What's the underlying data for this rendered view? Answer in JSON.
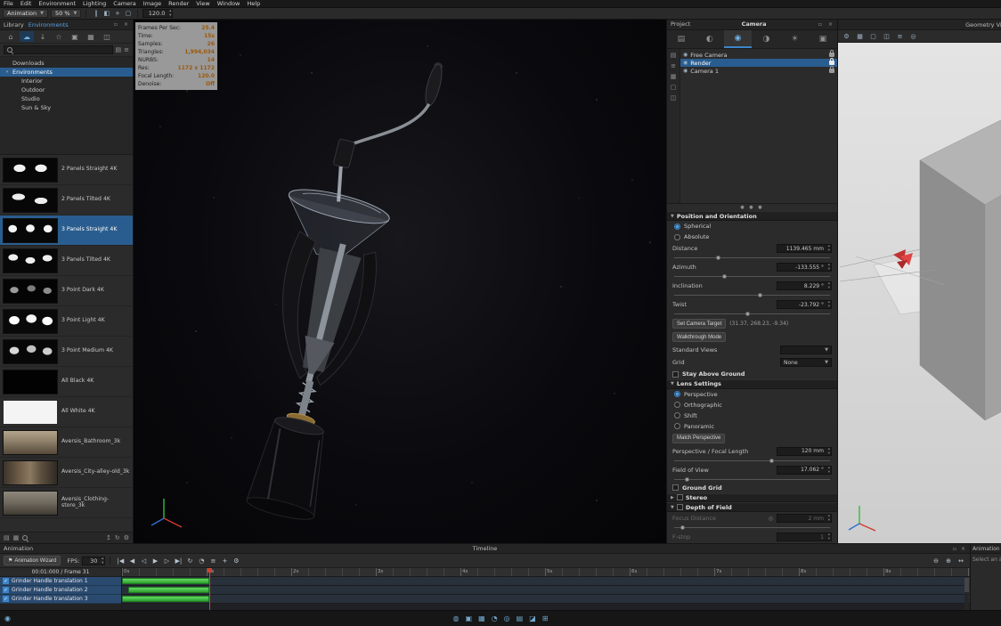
{
  "colors": {
    "accent": "#3d85c8",
    "selection": "#2a5d8f",
    "value_orange": "#c07a28",
    "track_green": "#3fc43f",
    "playhead_red": "#cc4433"
  },
  "menu": {
    "items": [
      "File",
      "Edit",
      "Environment",
      "Lighting",
      "Camera",
      "Image",
      "Render",
      "View",
      "Window",
      "Help"
    ]
  },
  "top_toolbar": {
    "animation_select": "Animation",
    "zoom_select": "50 %",
    "focal_value": "120.0",
    "icons": [
      {
        "name": "pause-icon",
        "glyph": "‖"
      },
      {
        "name": "keyframe-icon",
        "glyph": "◧"
      },
      {
        "name": "move-tool-icon",
        "glyph": "+"
      },
      {
        "name": "region-icon",
        "glyph": "▢"
      }
    ]
  },
  "library": {
    "title": "Library",
    "tab": "Environments",
    "toolbar_icons": [
      {
        "name": "home-icon",
        "glyph": "⌂",
        "active": false
      },
      {
        "name": "cloud-icon",
        "glyph": "☁",
        "active": true
      },
      {
        "name": "download-icon",
        "glyph": "↓",
        "active": false
      },
      {
        "name": "favorites-icon",
        "glyph": "☆",
        "active": false
      },
      {
        "name": "materials-icon",
        "glyph": "▣",
        "active": false
      },
      {
        "name": "textures-icon",
        "glyph": "▦",
        "active": false
      },
      {
        "name": "models-icon",
        "glyph": "◫",
        "active": false
      }
    ],
    "tree": [
      {
        "label": "Downloads",
        "depth": 0,
        "selected": false,
        "caret": ""
      },
      {
        "label": "Environments",
        "depth": 0,
        "selected": true,
        "caret": "▾"
      },
      {
        "label": "Interior",
        "depth": 1,
        "selected": false,
        "caret": ""
      },
      {
        "label": "Outdoor",
        "depth": 1,
        "selected": false,
        "caret": ""
      },
      {
        "label": "Studio",
        "depth": 1,
        "selected": false,
        "caret": ""
      },
      {
        "label": "Sun & Sky",
        "depth": 1,
        "selected": false,
        "caret": ""
      }
    ],
    "items": [
      {
        "label": "2 Panels Straight 4K",
        "thumb": "panels2",
        "selected": false
      },
      {
        "label": "2 Panels Tilted 4K",
        "thumb": "panels2t",
        "selected": false
      },
      {
        "label": "3 Panels Straight 4K",
        "thumb": "panels3",
        "selected": true
      },
      {
        "label": "3 Panels Tilted 4K",
        "thumb": "panels3t",
        "selected": false
      },
      {
        "label": "3 Point Dark 4K",
        "thumb": "pointdark",
        "selected": false
      },
      {
        "label": "3 Point Light 4K",
        "thumb": "pointlight",
        "selected": false
      },
      {
        "label": "3 Point Medium 4K",
        "thumb": "pointmedium",
        "selected": false
      },
      {
        "label": "All Black 4K",
        "thumb": "black",
        "selected": false
      },
      {
        "label": "All White 4K",
        "thumb": "white",
        "selected": false
      },
      {
        "label": "Aversis_Bathroom_3k",
        "thumb": "bathroom",
        "selected": false
      },
      {
        "label": "Aversis_City-alley-old_3k",
        "thumb": "city",
        "selected": false
      },
      {
        "label": "Aversis_Clothing-store_3k",
        "thumb": "store",
        "selected": false
      }
    ],
    "footer_icons_left": [
      {
        "name": "list-view-icon",
        "glyph": "▤"
      },
      {
        "name": "grid-view-icon",
        "glyph": "▦"
      },
      {
        "name": "search-icon",
        "glyph": "mag"
      }
    ],
    "footer_icons_right": [
      {
        "name": "import-icon",
        "glyph": "↥"
      },
      {
        "name": "refresh-icon",
        "glyph": "↻"
      },
      {
        "name": "settings-icon",
        "glyph": "⚙"
      }
    ]
  },
  "viewport": {
    "stats": [
      {
        "label": "Frames Per Sec:",
        "value": "25.4"
      },
      {
        "label": "Time:",
        "value": "15s"
      },
      {
        "label": "Samples:",
        "value": "26"
      },
      {
        "label": "Triangles:",
        "value": "1,994,034"
      },
      {
        "label": "NURBS:",
        "value": "14"
      },
      {
        "label": "Res:",
        "value": "1172 x 1172"
      },
      {
        "label": "Focal Length:",
        "value": "120.0"
      },
      {
        "label": "Denoise:",
        "value": "Off"
      }
    ]
  },
  "project": {
    "title": "Project",
    "panel_title": "Camera",
    "tabs": [
      {
        "name": "scene-tab",
        "glyph": "▤",
        "active": false
      },
      {
        "name": "material-tab",
        "glyph": "◐",
        "active": false
      },
      {
        "name": "camera-tab",
        "glyph": "◉",
        "active": true
      },
      {
        "name": "environment-tab",
        "glyph": "◑",
        "active": false
      },
      {
        "name": "lighting-tab",
        "glyph": "☀",
        "active": false
      },
      {
        "name": "image-tab",
        "glyph": "▣",
        "active": false
      }
    ],
    "side_icons": [
      {
        "name": "camera-list-icon",
        "glyph": "▤"
      },
      {
        "name": "folders-icon",
        "glyph": "≡"
      },
      {
        "name": "grid-icon",
        "glyph": "▦"
      },
      {
        "name": "tag-icon",
        "glyph": "▢"
      },
      {
        "name": "filter-icon",
        "glyph": "◫"
      }
    ],
    "cameras": [
      {
        "label": "Free Camera",
        "selected": false
      },
      {
        "label": "Render",
        "selected": true
      },
      {
        "label": "Camera 1",
        "selected": false
      }
    ],
    "position": {
      "title": "Position and Orientation",
      "modes": [
        {
          "label": "Spherical",
          "selected": true
        },
        {
          "label": "Absolute",
          "selected": false
        }
      ],
      "fields": [
        {
          "label": "Distance",
          "value": "1139.465 mm",
          "slider": 0.28
        },
        {
          "label": "Azimuth",
          "value": "-133.555 °",
          "slider": 0.32
        },
        {
          "label": "Inclination",
          "value": "8.229 °",
          "slider": 0.55
        },
        {
          "label": "Twist",
          "value": "-23.792 °",
          "slider": 0.47
        }
      ],
      "set_target_button": "Set Camera Target",
      "target_coords": "(31.37, 268.23, -9.34)",
      "walkthrough_button": "Walkthrough Mode",
      "standard_views_label": "Standard Views",
      "standard_views_value": "",
      "grid_label": "Grid",
      "grid_value": "None",
      "stay_above_ground": "Stay Above Ground"
    },
    "lens": {
      "title": "Lens Settings",
      "modes": [
        {
          "label": "Perspective",
          "selected": true
        },
        {
          "label": "Orthographic",
          "selected": false
        },
        {
          "label": "Shift",
          "selected": false
        },
        {
          "label": "Panoramic",
          "selected": false
        }
      ],
      "match_button": "Match Perspective",
      "focal_label": "Perspective / Focal Length",
      "focal_value": "120 mm",
      "focal_slider": 0.62,
      "fov_label": "Field of View",
      "fov_value": "17.062 °",
      "fov_slider": 0.08,
      "ground_grid": "Ground Grid"
    },
    "stereo": {
      "title": "Stereo"
    },
    "dof": {
      "title": "Depth of Field",
      "focus_label": "Focus Distance",
      "focus_value": "2 mm",
      "focus_slider": 0.05,
      "fstop_label": "F-stop",
      "fstop_value": "1"
    }
  },
  "geometry": {
    "title": "Geometry View",
    "toolbar_icons": [
      {
        "name": "settings-icon",
        "glyph": "⚙"
      },
      {
        "name": "wireframe-icon",
        "glyph": "▦"
      },
      {
        "name": "bounds-icon",
        "glyph": "▢"
      },
      {
        "name": "camera-icon",
        "glyph": "◫"
      },
      {
        "name": "layers-icon",
        "glyph": "≡"
      },
      {
        "name": "target-icon",
        "glyph": "◎"
      }
    ]
  },
  "timeline": {
    "panel_title": "Animation",
    "header_title": "Timeline",
    "wizard_button": "Animation Wizard",
    "fps_label": "FPS:",
    "fps_value": "30",
    "time_display": "00:01:000 / Frame 31",
    "transport_icons": [
      {
        "name": "go-start-icon",
        "glyph": "|◀"
      },
      {
        "name": "step-back-icon",
        "glyph": "◀"
      },
      {
        "name": "play-reverse-icon",
        "glyph": "◁"
      },
      {
        "name": "play-icon",
        "glyph": "▶"
      },
      {
        "name": "step-forward-icon",
        "glyph": "▷"
      },
      {
        "name": "go-end-icon",
        "glyph": "▶|"
      },
      {
        "name": "loop-icon",
        "glyph": "↻"
      },
      {
        "name": "realtime-icon",
        "glyph": "◔"
      },
      {
        "name": "filter-icon",
        "glyph": "≡"
      },
      {
        "name": "add-keyframe-icon",
        "glyph": "+"
      },
      {
        "name": "settings-icon",
        "glyph": "⚙"
      }
    ],
    "zoom_icons": [
      {
        "name": "zoom-out-icon",
        "glyph": "⊖"
      },
      {
        "name": "zoom-in-icon",
        "glyph": "⊕"
      },
      {
        "name": "fit-icon",
        "glyph": "↔"
      }
    ],
    "ruler_labels": [
      "0s",
      "1s",
      "2s",
      "3s",
      "4s",
      "5s",
      "6s",
      "7s",
      "8s",
      "9s"
    ],
    "playhead_seconds": 1.03,
    "tracks": [
      {
        "label": "Grinder Handle translation 1",
        "checked": true,
        "bar_start": 0.0,
        "bar_end": 1.03
      },
      {
        "label": "Grinder Handle translation 2",
        "checked": true,
        "bar_start": 0.07,
        "bar_end": 1.03
      },
      {
        "label": "Grinder Handle translation 3",
        "checked": true,
        "bar_start": 0.0,
        "bar_end": 1.03
      }
    ]
  },
  "side_animation": {
    "title": "Animation",
    "hint": "Select an ani"
  },
  "statusbar": {
    "left_icon": {
      "name": "status-menu-icon",
      "glyph": "◉"
    },
    "icons": [
      {
        "name": "sphere-icon",
        "glyph": "◍"
      },
      {
        "name": "image-icon",
        "glyph": "▣"
      },
      {
        "name": "screens-icon",
        "glyph": "▦"
      },
      {
        "name": "pie-icon",
        "glyph": "◔"
      },
      {
        "name": "target-icon",
        "glyph": "◎"
      },
      {
        "name": "layers-icon",
        "glyph": "▤"
      },
      {
        "name": "cube-icon",
        "glyph": "◪"
      },
      {
        "name": "grid-icon",
        "glyph": "⊞"
      }
    ]
  }
}
